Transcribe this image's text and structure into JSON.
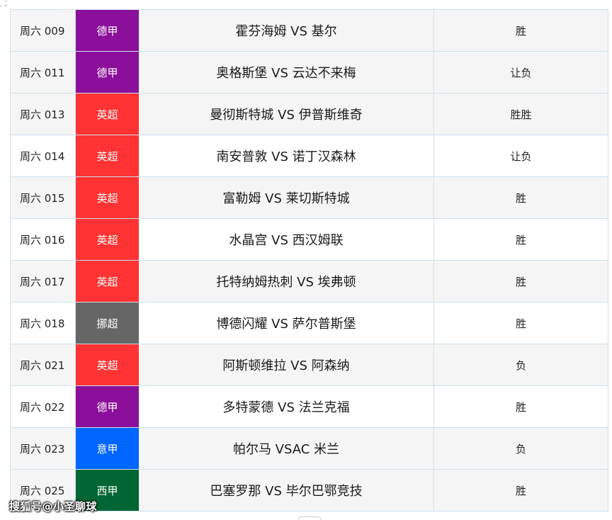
{
  "colors": {
    "bundesliga": "#8b0f9a",
    "premier_league": "#ff3333",
    "eliteserien": "#666666",
    "serie_a": "#0066ff",
    "la_liga": "#006633"
  },
  "rows": [
    {
      "code": "周六 009",
      "league": "德甲",
      "league_color": "#8b0f9a",
      "match": "霍芬海姆 VS 基尔",
      "result": "胜"
    },
    {
      "code": "周六 011",
      "league": "德甲",
      "league_color": "#8b0f9a",
      "match": "奥格斯堡 VS 云达不来梅",
      "result": "让负"
    },
    {
      "code": "周六 013",
      "league": "英超",
      "league_color": "#ff3333",
      "match": "曼彻斯特城 VS 伊普斯维奇",
      "result": "胜胜"
    },
    {
      "code": "周六 014",
      "league": "英超",
      "league_color": "#ff3333",
      "match": "南安普敦 VS 诺丁汉森林",
      "result": "让负"
    },
    {
      "code": "周六 015",
      "league": "英超",
      "league_color": "#ff3333",
      "match": "富勒姆 VS 莱切斯特城",
      "result": "胜"
    },
    {
      "code": "周六 016",
      "league": "英超",
      "league_color": "#ff3333",
      "match": "水晶宫 VS 西汉姆联",
      "result": "胜"
    },
    {
      "code": "周六 017",
      "league": "英超",
      "league_color": "#ff3333",
      "match": "托特纳姆热刺 VS 埃弗顿",
      "result": "胜"
    },
    {
      "code": "周六 018",
      "league": "挪超",
      "league_color": "#666666",
      "match": "博德闪耀 VS 萨尔普斯堡",
      "result": "胜"
    },
    {
      "code": "周六 021",
      "league": "英超",
      "league_color": "#ff3333",
      "match": "阿斯顿维拉 VS 阿森纳",
      "result": "负"
    },
    {
      "code": "周六 022",
      "league": "德甲",
      "league_color": "#8b0f9a",
      "match": "多特蒙德 VS 法兰克福",
      "result": "胜"
    },
    {
      "code": "周六 023",
      "league": "意甲",
      "league_color": "#0066ff",
      "match": "帕尔马 VSAC 米兰",
      "result": "负"
    },
    {
      "code": "周六 025",
      "league": "西甲",
      "league_color": "#006633",
      "match": "巴塞罗那 VS 毕尔巴鄂竞技",
      "result": "胜"
    }
  ],
  "watermark": "搜狐号@小圣聊球"
}
